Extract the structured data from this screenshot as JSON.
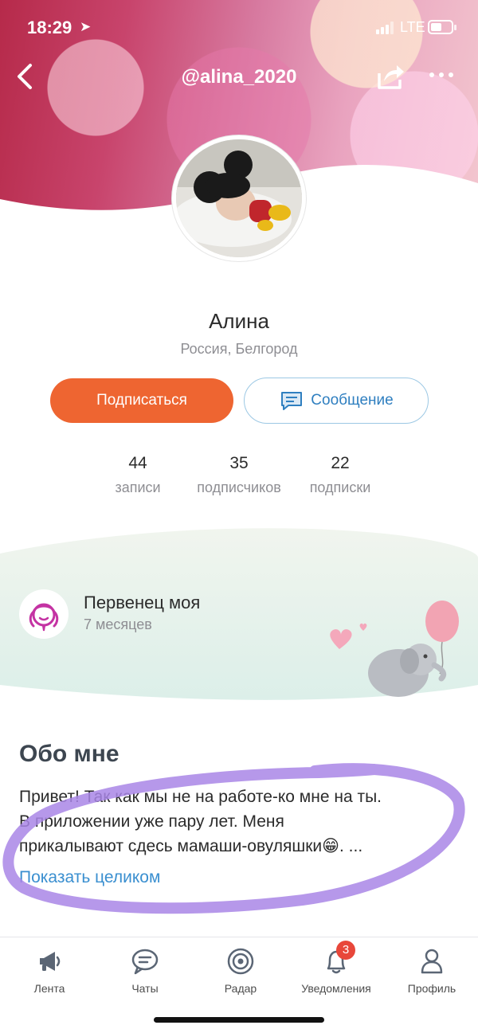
{
  "status_bar": {
    "time": "18:29",
    "network": "LTE"
  },
  "nav": {
    "title": "@alina_2020"
  },
  "profile": {
    "name": "Алина",
    "location": "Россия, Белгород",
    "subscribe_label": "Подписаться",
    "message_label": "Сообщение"
  },
  "stats": [
    {
      "value": "44",
      "label": "записи"
    },
    {
      "value": "35",
      "label": "подписчиков"
    },
    {
      "value": "22",
      "label": "подписки"
    }
  ],
  "child": {
    "title": "Первенец моя",
    "age": "7 месяцев"
  },
  "about": {
    "title": "Обо мне",
    "lines": [
      "Привет! Так как мы не на работе-ко мне на ты.",
      "В приложении уже пару лет. Меня",
      "прикалывают сдесь мамаши-овуляшки😁. ..."
    ],
    "show_more": "Показать целиком"
  },
  "tabs": [
    {
      "label": "Лента",
      "icon": "megaphone-icon"
    },
    {
      "label": "Чаты",
      "icon": "chat-icon"
    },
    {
      "label": "Радар",
      "icon": "radar-icon"
    },
    {
      "label": "Уведомления",
      "icon": "bell-icon",
      "badge": "3"
    },
    {
      "label": "Профиль",
      "icon": "user-icon"
    }
  ],
  "colors": {
    "accent_orange": "#ee6531",
    "link_blue": "#3a8fd0",
    "scribble": "#a986e6",
    "badge_red": "#e8473a"
  }
}
